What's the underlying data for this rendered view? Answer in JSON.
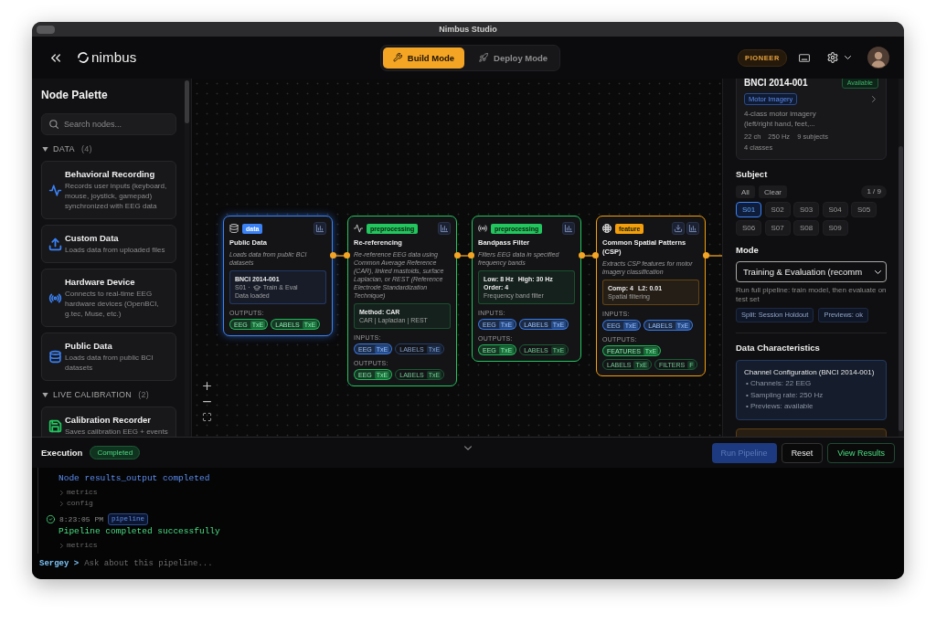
{
  "window": {
    "title": "Nimbus Studio"
  },
  "header": {
    "logo": "nimbus",
    "modes": [
      {
        "label": "Build Mode",
        "selected": true
      },
      {
        "label": "Deploy Mode",
        "selected": false
      }
    ],
    "badge": "PIONEER"
  },
  "palette": {
    "title": "Node Palette",
    "search": {
      "placeholder": "Search nodes..."
    },
    "sections": [
      {
        "label": "DATA",
        "count": "(4)",
        "expanded": true,
        "items": [
          {
            "title": "Behavioral Recording",
            "description": "Records user inputs (keyboard, mouse, joystick, gamepad) synchronized with EEG data",
            "color": "#3b82f6"
          },
          {
            "title": "Custom Data",
            "description": "Loads data from uploaded files",
            "color": "#3b82f6"
          },
          {
            "title": "Hardware Device",
            "description": "Connects to real-time EEG hardware devices (OpenBCI, g.tec, Muse, etc.)",
            "color": "#3b82f6"
          },
          {
            "title": "Public Data",
            "description": "Loads data from public BCI datasets",
            "color": "#3b82f6"
          }
        ]
      },
      {
        "label": "LIVE CALIBRATION",
        "count": "(2)",
        "expanded": true,
        "items": [
          {
            "title": "Calibration Recorder",
            "description": "Saves calibration EEG + events",
            "color": "#22c55e"
          }
        ]
      }
    ]
  },
  "canvas": {
    "nodes": [
      {
        "title": "Public Data",
        "badge": "data",
        "color": "#3b82f6",
        "selected": true,
        "description": "Loads data from public BCI datasets",
        "info": {
          "params": [
            "BNCI 2014-001"
          ],
          "lines": [
            {
              "prefix": "S01 ·",
              "text": "Train & Eval"
            },
            {
              "text": "Data loaded"
            }
          ]
        },
        "outputs": {
          "label": "OUTPUTS:",
          "ports": [
            {
              "name": "EEG",
              "type": "TxE",
              "connected": true
            },
            {
              "name": "LABELS",
              "type": "TxE",
              "connected": true
            }
          ]
        }
      },
      {
        "title": "Re-referencing",
        "badge": "preprocessing",
        "color": "#22c55e",
        "selected": false,
        "description": "Re-reference EEG data using Common Average Reference (CAR), linked mastoids, surface Laplacian, or REST (Reference Electrode Standardization Technique)",
        "info": {
          "params": [
            "Method: CAR"
          ],
          "lines": [
            {
              "text": "CAR | Laplacian | REST"
            }
          ]
        },
        "inputs": {
          "label": "INPUTS:",
          "ports": [
            {
              "name": "EEG",
              "type": "TxE",
              "connected": true
            },
            {
              "name": "LABELS",
              "type": "TxE",
              "connected": false
            }
          ]
        },
        "outputs": {
          "label": "OUTPUTS:",
          "ports": [
            {
              "name": "EEG",
              "type": "TxE",
              "connected": true
            },
            {
              "name": "LABELS",
              "type": "TxE",
              "connected": false
            }
          ]
        }
      },
      {
        "title": "Bandpass Filter",
        "badge": "preprocessing",
        "color": "#22c55e",
        "selected": false,
        "description": "Filters EEG data in specified frequency bands",
        "info": {
          "params": [
            "Low: 8 Hz",
            "High: 30 Hz",
            "Order: 4"
          ],
          "lines": [
            {
              "text": "Frequency band filter"
            }
          ]
        },
        "inputs": {
          "label": "INPUTS:",
          "ports": [
            {
              "name": "EEG",
              "type": "TxE",
              "connected": true
            },
            {
              "name": "LABELS",
              "type": "TxE",
              "connected": true
            }
          ]
        },
        "outputs": {
          "label": "OUTPUTS:",
          "ports": [
            {
              "name": "EEG",
              "type": "TxE",
              "connected": true
            },
            {
              "name": "LABELS",
              "type": "TxE",
              "connected": false
            }
          ]
        }
      },
      {
        "title": "Common Spatial Patterns (CSP)",
        "badge": "feature",
        "color": "#f59e0b",
        "selected": false,
        "description": "Extracts CSP features for motor imagery classification",
        "info": {
          "params": [
            "Comp: 4",
            "L2: 0.01"
          ],
          "lines": [
            {
              "text": "Spatial filtering"
            }
          ]
        },
        "inputs": {
          "label": "INPUTS:",
          "ports": [
            {
              "name": "EEG",
              "type": "TxE",
              "connected": true
            },
            {
              "name": "LABELS",
              "type": "TxE",
              "connected": true
            }
          ]
        },
        "outputs": {
          "label": "OUTPUTS:",
          "ports": [
            {
              "name": "FEATURES",
              "type": "TxE",
              "connected": true
            },
            {
              "name": "LABELS",
              "type": "TxE",
              "connected": false
            },
            {
              "name": "FILTERS",
              "type": "F",
              "connected": false
            }
          ]
        }
      }
    ]
  },
  "inspector": {
    "dataset": {
      "title": "BNCI 2014-001",
      "status": "Available",
      "tag": "Motor Imagery",
      "description": "4-class motor imagery (left/right hand, feet,...",
      "stats": [
        "22 ch",
        "250 Hz",
        "9 subjects"
      ],
      "classes": "4 classes"
    },
    "subject": {
      "label": "Subject",
      "actions": [
        "All",
        "Clear"
      ],
      "counter": "1 / 9",
      "options": [
        {
          "label": "S01",
          "selected": true
        },
        {
          "label": "S02",
          "selected": false
        },
        {
          "label": "S03",
          "selected": false
        },
        {
          "label": "S04",
          "selected": false
        },
        {
          "label": "S05",
          "selected": false
        },
        {
          "label": "S06",
          "selected": false
        },
        {
          "label": "S07",
          "selected": false
        },
        {
          "label": "S08",
          "selected": false
        },
        {
          "label": "S09",
          "selected": false
        }
      ]
    },
    "mode": {
      "label": "Mode",
      "value": "Training & Evaluation (recomm",
      "hint": "Run full pipeline: train model, then evaluate on test set",
      "chips": [
        "Split: Session Holdout",
        "Previews: ok"
      ]
    },
    "characteristics": {
      "title": "Data Characteristics",
      "cards": [
        {
          "title": "Channel Configuration (BNCI 2014-001)",
          "items": [
            "• Channels: 22 EEG",
            "• Sampling rate: 250 Hz",
            "• Previews: available"
          ],
          "color": "#22395e"
        },
        {
          "color": "#5a3c14"
        }
      ]
    }
  },
  "execution": {
    "title": "Execution",
    "status": "Completed",
    "buttons": [
      {
        "label": "Run Pipeline",
        "kind": "primary",
        "disabled": true
      },
      {
        "label": "Reset",
        "kind": "secondary",
        "disabled": false
      },
      {
        "label": "View Results",
        "kind": "success",
        "disabled": false
      }
    ]
  },
  "console": {
    "entries": [
      {
        "kind": "info",
        "message": "Node results_output completed",
        "details": [
          {
            "label": "metrics",
            "expanded": false
          },
          {
            "label": "config",
            "expanded": false
          }
        ]
      },
      {
        "kind": "success",
        "time": "8:23:05 PM",
        "tag": "pipeline",
        "message": "Pipeline completed successfully",
        "details": [
          {
            "label": "metrics",
            "expanded": false
          }
        ]
      }
    ],
    "prompt": {
      "user": "Sergey >",
      "placeholder": "Ask about this pipeline..."
    }
  }
}
